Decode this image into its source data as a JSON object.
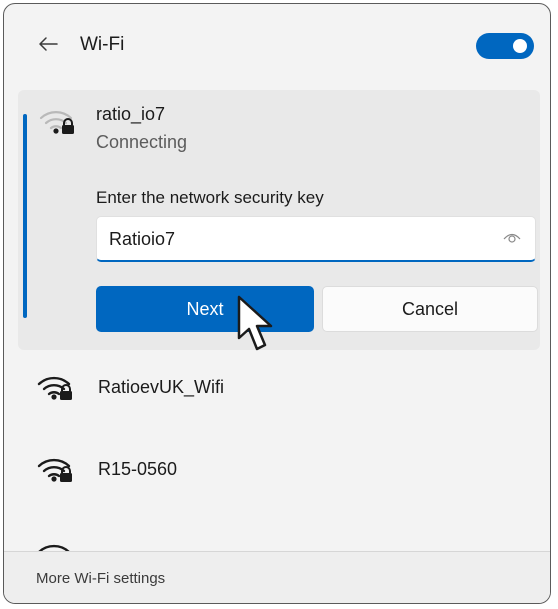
{
  "header": {
    "title": "Wi-Fi",
    "back_icon": "back-arrow-icon",
    "toggle_state": "on"
  },
  "active_network": {
    "name": "ratio_io7",
    "status": "Connecting",
    "icon": "wifi-secured-icon",
    "key_prompt": "Enter the network security key",
    "key_value": "Ratioio7",
    "reveal_icon": "eye-icon",
    "next_label": "Next",
    "cancel_label": "Cancel"
  },
  "networks": [
    {
      "name": "RatioevUK_Wifi",
      "icon": "wifi-secured-icon"
    },
    {
      "name": "R15-0560",
      "icon": "wifi-secured-icon"
    }
  ],
  "footer": {
    "link_label": "More Wi-Fi settings"
  },
  "colors": {
    "accent": "#0067c0",
    "panel_bg": "#f3f3f3",
    "expanded_bg": "#e9e9e9"
  }
}
